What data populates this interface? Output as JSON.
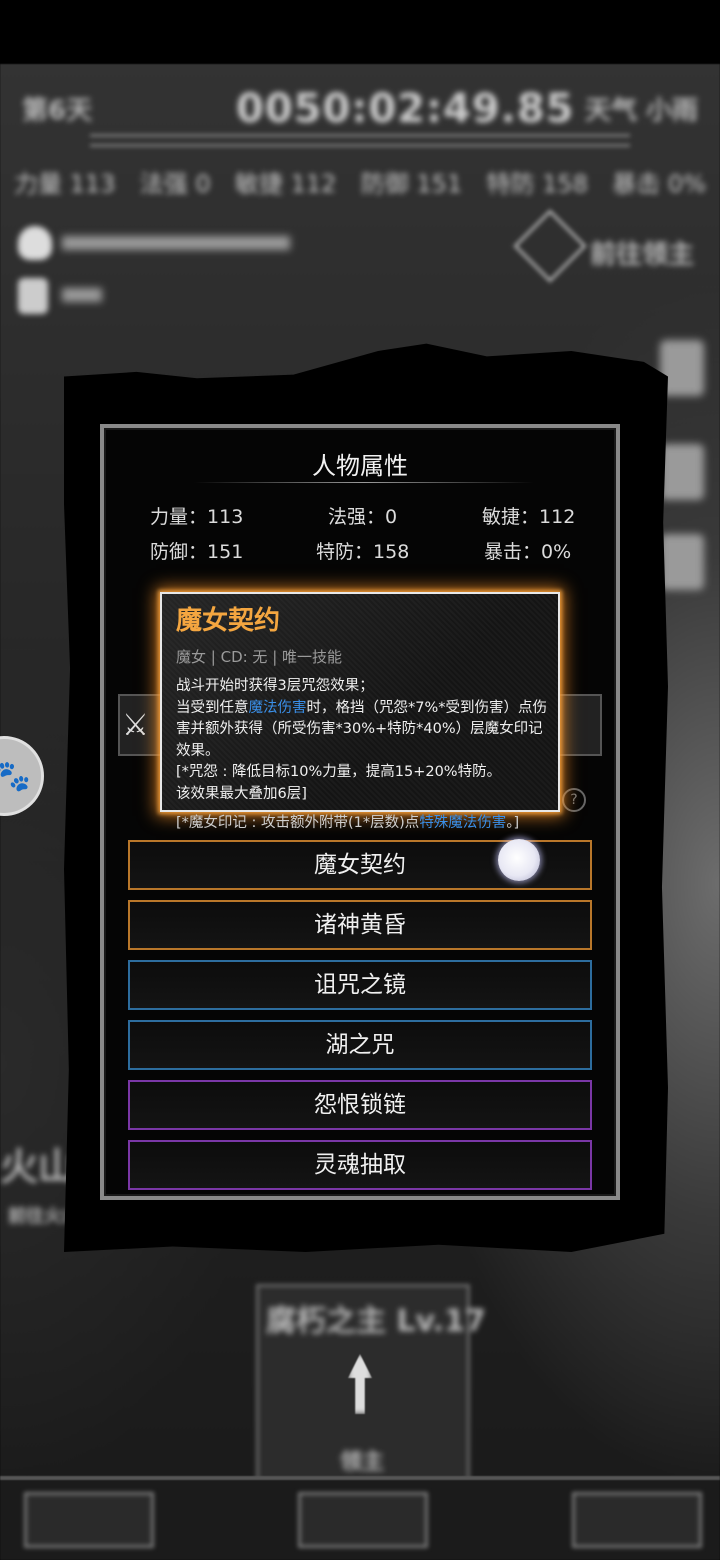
{
  "background": {
    "day": "第6天",
    "clock": "0050:02:49.85",
    "weather": "天气 小雨",
    "stats": [
      "力量 113",
      "法强 0",
      "敏捷 112",
      "防御 151",
      "特防 158",
      "暴击 0%"
    ],
    "boss_label": "前往领主",
    "area": "火山",
    "area_sub": "前往火山",
    "card_title": "腐朽之主 Lv.17",
    "card_action": "领主"
  },
  "panel": {
    "title": "人物属性",
    "stats": [
      {
        "label": "力量：",
        "value": "113"
      },
      {
        "label": "法强：",
        "value": "0"
      },
      {
        "label": "敏捷：",
        "value": "112"
      },
      {
        "label": "防御：",
        "value": "151"
      },
      {
        "label": "特防：",
        "value": "158"
      },
      {
        "label": "暴击：",
        "value": "0%"
      }
    ]
  },
  "tooltip": {
    "title": "魔女契约",
    "meta": "魔女 | CD: 无 | 唯一技能",
    "line1": "战斗开始时获得3层咒怨效果；",
    "line2_pre": "当受到任意",
    "line2_hl": "魔法伤害",
    "line2_post": "时，格挡（咒怨*7%*受到伤害）点伤害并额外获得（所受伤害*30%+特防*40%）层魔女印记效果。",
    "line3": "[*咒怨 : 降低目标10%力量，提高15+20%特防。",
    "line4": "该效果最大叠加6层]",
    "overflow_pre": "[*魔女印记 : 攻击额外附带(1*层数)点",
    "overflow_hl": "特殊魔法伤害",
    "overflow_post": "。]"
  },
  "skills": [
    {
      "label": "魔女契约",
      "tier": "orange"
    },
    {
      "label": "诸神黄昏",
      "tier": "orange"
    },
    {
      "label": "诅咒之镜",
      "tier": "blue"
    },
    {
      "label": "湖之咒",
      "tier": "blue"
    },
    {
      "label": "怨恨锁链",
      "tier": "purple"
    },
    {
      "label": "灵魂抽取",
      "tier": "purple"
    }
  ],
  "colors": {
    "orange_border": "#b9772a",
    "blue_border": "#2d6d9e",
    "purple_border": "#7a37a6",
    "tooltip_title": "#f4a640",
    "highlight": "#3a8fe8"
  },
  "icons": {
    "slot_left": "crossed-swords-icon",
    "help": "question-icon",
    "avatar": "pet-avatar"
  }
}
